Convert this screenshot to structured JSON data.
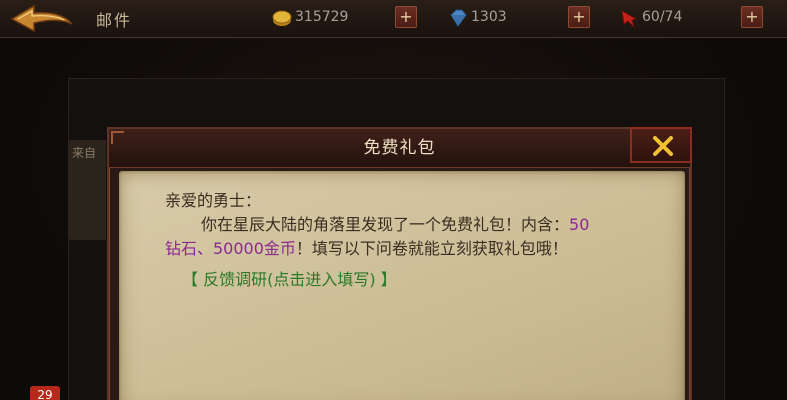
{
  "topbar": {
    "title": "邮件",
    "gold": "315729",
    "gems": "1303",
    "stamina": "60/74",
    "plus_label": "+"
  },
  "mail": {
    "from_label": "来自",
    "badge_count": "29"
  },
  "dialog": {
    "title": "免费礼包",
    "greeting": "亲爱的勇士：",
    "line1_a": "你在星辰大陆的角落里发现了一个免费礼包！内含：",
    "line1_b": "50",
    "line2_a": "钻石、50000金币",
    "line2_b": "！填写以下问卷就能立刻获取礼包哦！",
    "link": "【 反馈调研(点击进入填写) 】"
  },
  "colors": {
    "reward_purple": "#8b2a8e",
    "link_green": "#2a7a28",
    "close_x": "#f1c232"
  },
  "icons": [
    "back-arrow-icon",
    "gold-coin-icon",
    "gem-icon",
    "stamina-icon",
    "plus-icon",
    "close-icon"
  ]
}
